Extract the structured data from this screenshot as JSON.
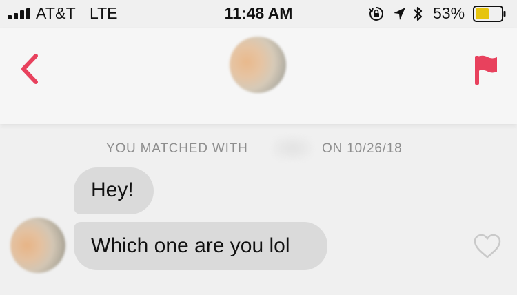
{
  "status_bar": {
    "carrier": "AT&T",
    "network": "LTE",
    "time": "11:48 AM",
    "battery_percent": "53%",
    "battery_level": 0.53,
    "icons": [
      "signal-bars-icon",
      "rotation-lock-icon",
      "location-arrow-icon",
      "bluetooth-icon",
      "battery-icon"
    ]
  },
  "header": {
    "back_icon": "chevron-left-icon",
    "report_icon": "flag-icon",
    "accent_color": "#e8415d"
  },
  "chat": {
    "match_note_prefix": "YOU MATCHED WITH",
    "match_note_suffix": "ON 10/26/18",
    "messages": [
      {
        "text": "Hey!"
      },
      {
        "text": "Which one are you lol"
      }
    ],
    "like_icon": "heart-outline-icon",
    "bubble_color": "#dadada"
  }
}
